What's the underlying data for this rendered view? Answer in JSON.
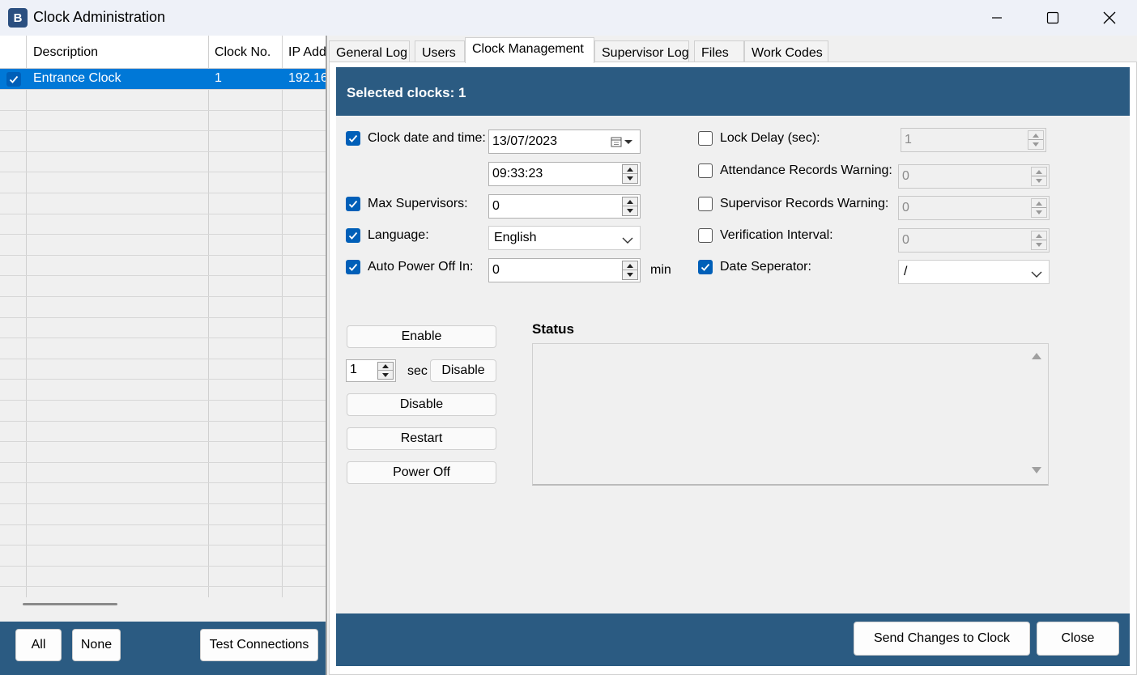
{
  "window": {
    "title": "Clock Administration",
    "app_icon_glyph": "B",
    "controls": [
      "minimize-icon",
      "maximize-icon",
      "close-icon"
    ]
  },
  "grid": {
    "columns": [
      "Description",
      "Clock No.",
      "IP Add"
    ],
    "rows": [
      {
        "checked": true,
        "description": "Entrance Clock",
        "clock_no": "1",
        "ip": "192.16"
      }
    ]
  },
  "left_footer": {
    "all_label": "All",
    "none_label": "None",
    "test_label": "Test Connections"
  },
  "tabs": [
    {
      "label": "General Log",
      "active": false
    },
    {
      "label": "Users",
      "active": false
    },
    {
      "label": "Clock Management",
      "active": true
    },
    {
      "label": "Supervisor Log",
      "active": false
    },
    {
      "label": "Files",
      "active": false
    },
    {
      "label": "Work Codes",
      "active": false
    }
  ],
  "banner": {
    "selected_label": "Selected clocks: 1"
  },
  "left_fields": {
    "clock_datetime": {
      "label": "Clock date and time:",
      "checked": true,
      "date": "13/07/2023",
      "time": "09:33:23"
    },
    "max_supervisors": {
      "label": "Max Supervisors:",
      "checked": true,
      "value": "0"
    },
    "language": {
      "label": "Language:",
      "checked": true,
      "value": "English"
    },
    "auto_power_off": {
      "label": "Auto Power Off In:",
      "checked": true,
      "value": "0",
      "unit": "min"
    }
  },
  "right_fields": {
    "lock_delay": {
      "label": "Lock Delay (sec):",
      "checked": false,
      "value": "1"
    },
    "attendance_warning": {
      "label": "Attendance Records Warning:",
      "checked": false,
      "value": "0"
    },
    "supervisor_warning": {
      "label": "Supervisor Records Warning:",
      "checked": false,
      "value": "0"
    },
    "verification_interval": {
      "label": "Verification Interval:",
      "checked": false,
      "value": "0"
    },
    "date_separator": {
      "label": "Date Seperator:",
      "checked": true,
      "value": "/"
    }
  },
  "actions": {
    "enable": "Enable",
    "timed_value": "1",
    "sec_label": "sec",
    "timed_disable": "Disable",
    "disable": "Disable",
    "restart": "Restart",
    "power_off": "Power Off"
  },
  "status": {
    "title": "Status",
    "text": ""
  },
  "bottom": {
    "send_label": "Send Changes to Clock",
    "close_label": "Close"
  },
  "colors": {
    "banner": "#2b5b82",
    "selection": "#0078d7",
    "checkbox": "#005fb8"
  }
}
